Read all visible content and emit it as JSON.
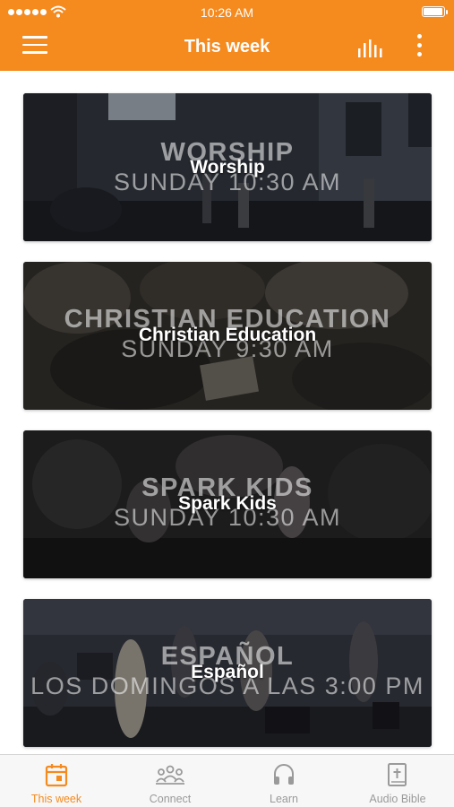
{
  "status_bar": {
    "time": "10:26 AM",
    "signal_dots": 5,
    "battery_level": 1.0
  },
  "nav": {
    "title": "This week",
    "menu_icon": "hamburger-menu-icon",
    "chart_icon": "bar-chart-icon",
    "more_icon": "more-vertical-icon"
  },
  "cards": [
    {
      "big_title": "WORSHIP",
      "subtitle": "SUNDAY 10:30 AM",
      "label": "Worship"
    },
    {
      "big_title": "CHRISTIAN EDUCATION",
      "subtitle": "SUNDAY 9:30 AM",
      "label": "Christian Education"
    },
    {
      "big_title": "SPARK KIDS",
      "subtitle": "SUNDAY 10:30 AM",
      "label": "Spark Kids"
    },
    {
      "big_title": "ESPAÑOL",
      "subtitle": "LOS DOMINGOS A LAS 3:00 PM",
      "label": "Español"
    }
  ],
  "tabs": [
    {
      "label": "This week",
      "icon": "calendar-icon",
      "active": true
    },
    {
      "label": "Connect",
      "icon": "people-group-icon",
      "active": false
    },
    {
      "label": "Learn",
      "icon": "headphones-icon",
      "active": false
    },
    {
      "label": "Audio Bible",
      "icon": "bible-book-icon",
      "active": false
    }
  ],
  "colors": {
    "accent": "#f58a1f",
    "tab_inactive": "#9a9a9a",
    "tabbar_bg": "#f7f7f7"
  }
}
